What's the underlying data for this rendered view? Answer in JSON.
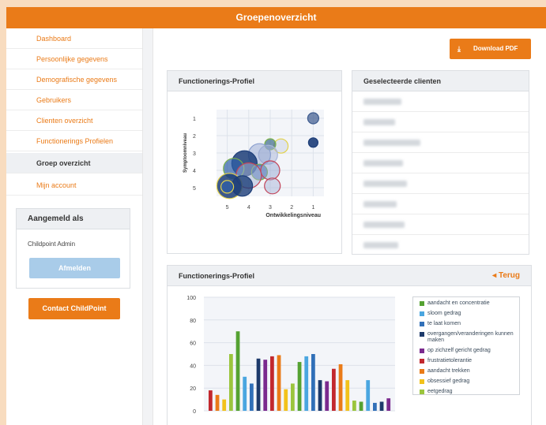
{
  "header": {
    "title": "Groepenoverzicht"
  },
  "sidebar": {
    "items": [
      {
        "label": "Dashboard",
        "active": false
      },
      {
        "label": "Persoonlijke gegevens",
        "active": false
      },
      {
        "label": "Demografische gegevens",
        "active": false
      },
      {
        "label": "Gebruikers",
        "active": false
      },
      {
        "label": "Clienten overzicht",
        "active": false
      },
      {
        "label": "Functionerings Profielen",
        "active": false
      },
      {
        "label": "Groep overzicht",
        "active": true
      },
      {
        "label": "Mijn account",
        "active": false
      }
    ],
    "login": {
      "title": "Aangemeld als",
      "user": "Childpoint Admin",
      "logout_label": "Afmelden"
    },
    "contact_label": "Contact ChildPoint"
  },
  "main": {
    "download_label": "Download PDF",
    "download_icon": "download-icon",
    "profile_panel": {
      "title": "Functionerings-Profiel"
    },
    "clients_panel": {
      "title": "Geselecteerde clienten"
    },
    "bar_panel": {
      "title": "Functionerings-Profiel",
      "back_label": "Terug"
    }
  },
  "colors": {
    "accent": "#ea7b18",
    "top_bg": "#f8dcbf",
    "panel_head": "#eef0f3"
  },
  "chart_data": [
    {
      "type": "scatter",
      "title": "",
      "xlabel": "Ontwikkelingsniveau",
      "ylabel": "Symptoomniveau",
      "x_ticks": [
        "5",
        "4",
        "3",
        "2",
        "1"
      ],
      "y_ticks": [
        "1",
        "2",
        "3",
        "4",
        "5"
      ],
      "xlim": [
        5.5,
        0.5
      ],
      "ylim": [
        5.5,
        0.5
      ],
      "grid": true,
      "points": [
        {
          "x": 1,
          "y": 1,
          "r": 7,
          "fill": "#3c5a8e",
          "stroke": "#3c5a8e",
          "fill_opacity": 0.7
        },
        {
          "x": 1,
          "y": 2.4,
          "r": 6,
          "fill": "#1c3d78",
          "stroke": "#1c3d78",
          "fill_opacity": 0.9
        },
        {
          "x": 2.5,
          "y": 2.6,
          "r": 9,
          "fill": "#c9d2e6",
          "stroke": "#e2d24a",
          "fill_opacity": 0.5
        },
        {
          "x": 3,
          "y": 2.5,
          "r": 7,
          "fill": "#3a6a8a",
          "stroke": "#7bb24a",
          "fill_opacity": 0.7
        },
        {
          "x": 3.1,
          "y": 3.1,
          "r": 12,
          "fill": "#a9b6d8",
          "stroke": "#a9b6d8",
          "fill_opacity": 0.5
        },
        {
          "x": 3.5,
          "y": 3.1,
          "r": 14,
          "fill": "#8b9fcf",
          "stroke": "#8b9fcf",
          "fill_opacity": 0.45
        },
        {
          "x": 4.2,
          "y": 3.6,
          "r": 16,
          "fill": "#1c3d78",
          "stroke": "#1c3d78",
          "fill_opacity": 0.85
        },
        {
          "x": 4.7,
          "y": 3.9,
          "r": 13,
          "fill": "#2d5fa8",
          "stroke": "#7bb24a",
          "fill_opacity": 0.7
        },
        {
          "x": 3.5,
          "y": 4.1,
          "r": 10,
          "fill": "#2d5fa8",
          "stroke": "#7bb24a",
          "fill_opacity": 0.6
        },
        {
          "x": 3.0,
          "y": 4.0,
          "r": 12,
          "fill": "#8b9fcf",
          "stroke": "#c2455a",
          "fill_opacity": 0.45
        },
        {
          "x": 4.0,
          "y": 4.3,
          "r": 16,
          "fill": "#a9b6d8",
          "stroke": "#c2455a",
          "fill_opacity": 0.5
        },
        {
          "x": 2.9,
          "y": 4.9,
          "r": 10,
          "fill": "#a9b6d8",
          "stroke": "#c2455a",
          "fill_opacity": 0.5
        },
        {
          "x": 4.9,
          "y": 4.9,
          "r": 16,
          "fill": "#1c3d78",
          "stroke": "#e2d24a",
          "fill_opacity": 0.85
        },
        {
          "x": 4.3,
          "y": 4.9,
          "r": 13,
          "fill": "#1c3d78",
          "stroke": "#1c3d78",
          "fill_opacity": 0.8
        },
        {
          "x": 5.0,
          "y": 4.95,
          "r": 8,
          "fill": "#2d5fa8",
          "stroke": "#e2d24a",
          "fill_opacity": 0.7
        }
      ]
    },
    {
      "type": "bar",
      "title": "",
      "xlabel": "",
      "ylabel": "",
      "ylim": [
        0,
        100
      ],
      "y_ticks": [
        0,
        20,
        40,
        60,
        80,
        100
      ],
      "grid": true,
      "legend": "right",
      "series": [
        {
          "name": "aandacht en concentratie",
          "color": "#55a232"
        },
        {
          "name": "sloom gedrag",
          "color": "#4aa6e0"
        },
        {
          "name": "te laat komen",
          "color": "#3170b8"
        },
        {
          "name": "overgangen/veranderingen kunnen maken",
          "color": "#1d3a6b"
        },
        {
          "name": "op zichzelf gericht gedrag",
          "color": "#7b2a8e"
        },
        {
          "name": "frustratietolerantie",
          "color": "#c2282e"
        },
        {
          "name": "aandacht trekken",
          "color": "#ea7b18"
        },
        {
          "name": "obsessief gedrag",
          "color": "#f2c21b"
        },
        {
          "name": "eetgedrag",
          "color": "#9bc53d"
        }
      ],
      "bars": [
        {
          "series": 5,
          "value": 18
        },
        {
          "series": 6,
          "value": 14
        },
        {
          "series": 7,
          "value": 10
        },
        {
          "series": 8,
          "value": 50
        },
        {
          "series": 0,
          "value": 70
        },
        {
          "series": 1,
          "value": 30
        },
        {
          "series": 2,
          "value": 24
        },
        {
          "series": 3,
          "value": 46
        },
        {
          "series": 4,
          "value": 45
        },
        {
          "series": 5,
          "value": 48
        },
        {
          "series": 6,
          "value": 49
        },
        {
          "series": 7,
          "value": 19
        },
        {
          "series": 8,
          "value": 24
        },
        {
          "series": 0,
          "value": 43
        },
        {
          "series": 1,
          "value": 48
        },
        {
          "series": 2,
          "value": 50
        },
        {
          "series": 3,
          "value": 27
        },
        {
          "series": 4,
          "value": 26
        },
        {
          "series": 5,
          "value": 37
        },
        {
          "series": 6,
          "value": 41
        },
        {
          "series": 7,
          "value": 27
        },
        {
          "series": 8,
          "value": 9
        },
        {
          "series": 0,
          "value": 8
        },
        {
          "series": 1,
          "value": 27
        },
        {
          "series": 2,
          "value": 7
        },
        {
          "series": 3,
          "value": 8
        },
        {
          "series": 4,
          "value": 11
        }
      ]
    }
  ]
}
